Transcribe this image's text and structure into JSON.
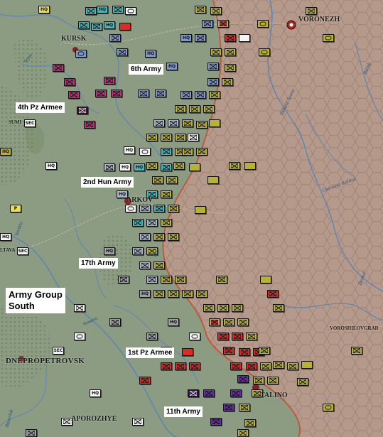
{
  "labels": {
    "army6": "6th Army",
    "pz4": "4th Pz Armee",
    "hun2": "2nd Hun Army",
    "army17": "17th Army",
    "group_line1": "Army Group",
    "group_line2": "South",
    "pz1": "1st Pz Armee",
    "army11": "11th Army"
  },
  "cities": {
    "kursk": "KURSK",
    "voronezh": "VORONEZH",
    "sumy": "SUMI",
    "kharkov": "ARKOV",
    "poltava": "LTAVA",
    "dnepropetrovsk": "DNEPROPETROVSK",
    "zaporozhye": "APOROZHYE",
    "stalino": "TALINO",
    "voroshilovgrad": "VOROSHILOVGRAD"
  },
  "rivers": {
    "seym": "Seym",
    "samara": "Samara",
    "chernaya": "Chernaya Kalitva",
    "tikhaya": "Tikhaya Sosna",
    "bitiug": "Bitiug",
    "vorskla": "Vorskla",
    "bazavluk": "Bazavluk",
    "udy": "Udy",
    "derkul": "Derkul"
  },
  "counter_symbols": {
    "inf": "infantry-x",
    "hq": "HQ",
    "sec": "SEC",
    "arm": "armor-oval",
    "blank": "blank",
    "para": "P"
  },
  "colors": {
    "soviet_hex": "#b19584",
    "open_terrain": "#8a9a80",
    "forest": "#6f8a5f",
    "river": "#5f86b4",
    "frontline": "#c83b1e"
  }
}
